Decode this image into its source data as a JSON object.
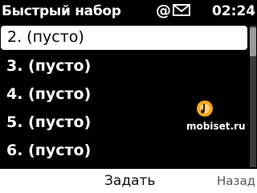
{
  "header": {
    "title": "Быстрый набор",
    "at_glyph": "@",
    "message_icon": "envelope-icon",
    "time": "02:24"
  },
  "list": {
    "items": [
      {
        "label": "2. (пусто)",
        "selected": true
      },
      {
        "label": "3. (пусто)",
        "selected": false
      },
      {
        "label": "4. (пусто)",
        "selected": false
      },
      {
        "label": "5. (пусто)",
        "selected": false
      },
      {
        "label": "6. (пусто)",
        "selected": false
      }
    ]
  },
  "watermark": {
    "text": "mobiset.ru",
    "logo_color": "#f5a623"
  },
  "softkeys": {
    "center": "Задать",
    "right": "Назад"
  }
}
